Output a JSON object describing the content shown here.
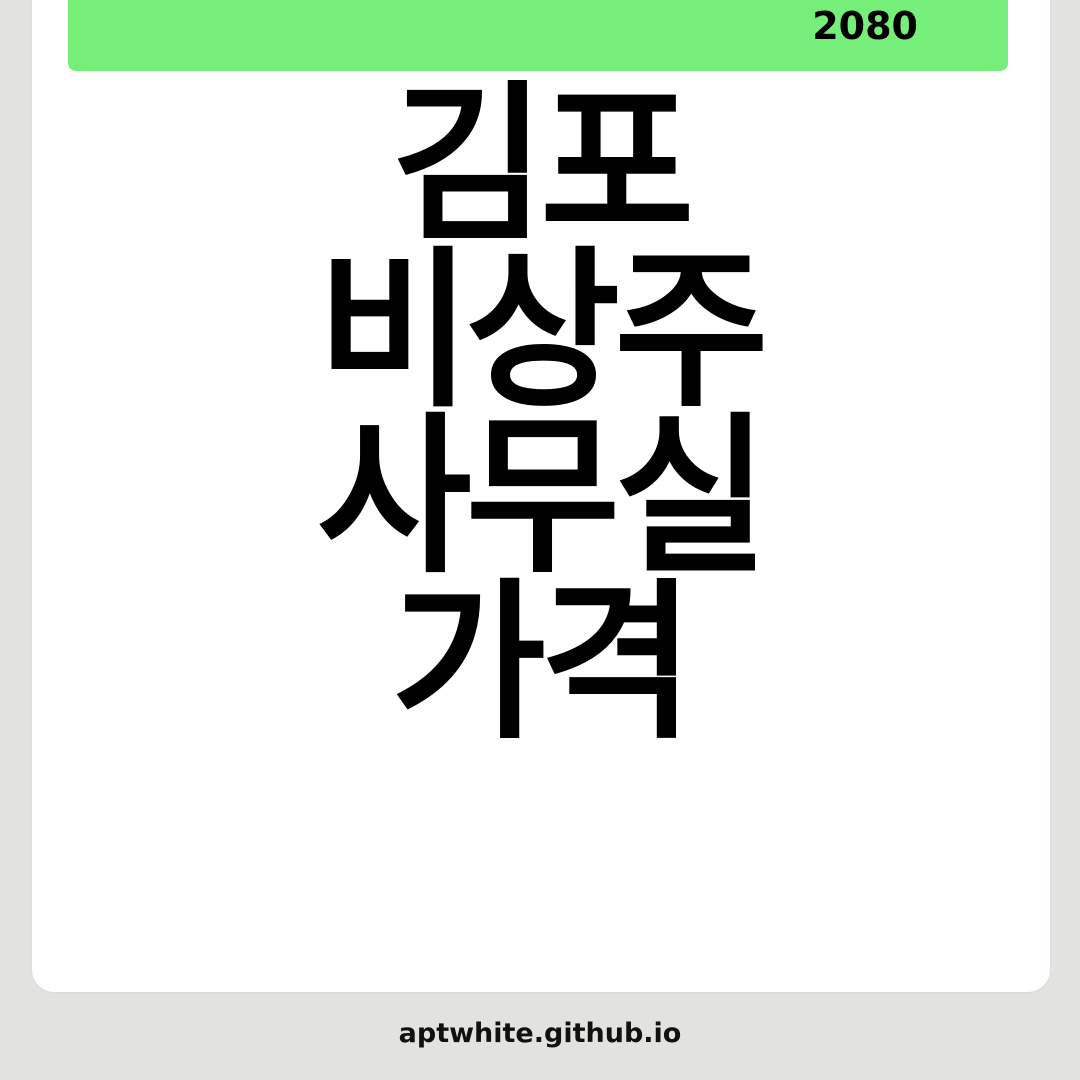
{
  "badge": {
    "number": "2080",
    "color": "#76ee7a"
  },
  "title": {
    "lines": [
      "김포",
      "비상주",
      "사무실",
      "가격"
    ]
  },
  "footer": {
    "url": "aptwhite.github.io"
  },
  "colors": {
    "background": "#e2e3df",
    "card": "#ffffff",
    "text": "#000000",
    "accent": "#76ee7a"
  }
}
